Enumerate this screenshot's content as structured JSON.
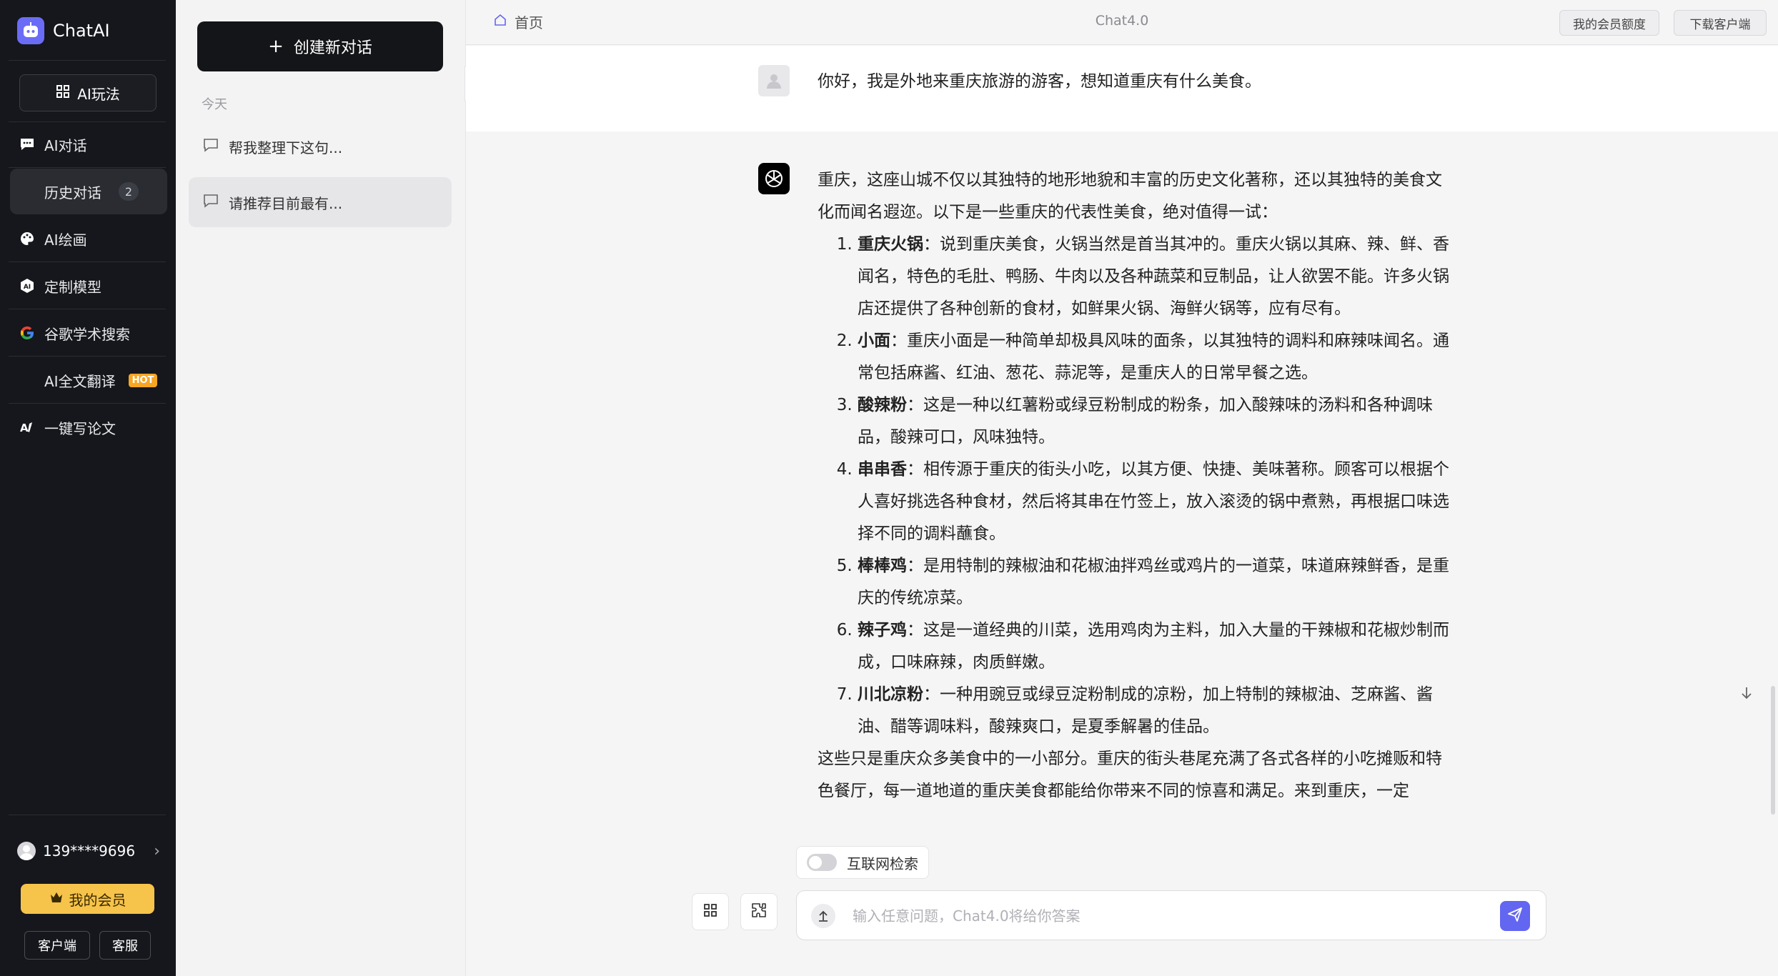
{
  "app": {
    "name": "ChatAI",
    "accent": "#6b6cf6"
  },
  "sidebar": {
    "ai_play_label": "AI玩法",
    "items": [
      {
        "label": "AI对话",
        "icon": "chat-bubble-icon"
      },
      {
        "label": "历史对话",
        "icon": "",
        "count": "2"
      },
      {
        "label": "AI绘画",
        "icon": "palette-icon"
      },
      {
        "label": "定制模型",
        "icon": "ai-model-icon"
      },
      {
        "label": "谷歌学术搜索",
        "icon": "google-icon"
      },
      {
        "label": "AI全文翻译",
        "icon": "",
        "badge": "HOT"
      },
      {
        "label": "一键写论文",
        "icon": "ai-write-icon"
      }
    ],
    "user_phone": "139****9696",
    "member_button": "我的会员",
    "client_button": "客户端",
    "service_button": "客服"
  },
  "conversations": {
    "new_chat_label": "创建新对话",
    "group_label": "今天",
    "items": [
      {
        "title": "帮我整理下这句..."
      },
      {
        "title": "请推荐目前最有..."
      }
    ]
  },
  "header": {
    "home_label": "首页",
    "model_title": "Chat4.0",
    "quota_button": "我的会员额度",
    "download_button": "下载客户端"
  },
  "chat": {
    "user_message": "你好，我是外地来重庆旅游的游客，想知道重庆有什么美食。",
    "intro": "重庆，这座山城不仅以其独特的地形地貌和丰富的历史文化著称，还以其独特的美食文化而闻名遐迩。以下是一些重庆的代表性美食，绝对值得一试：",
    "items": [
      {
        "name": "重庆火锅",
        "desc": "：说到重庆美食，火锅当然是首当其冲的。重庆火锅以其麻、辣、鲜、香闻名，特色的毛肚、鸭肠、牛肉以及各种蔬菜和豆制品，让人欲罢不能。许多火锅店还提供了各种创新的食材，如鲜果火锅、海鲜火锅等，应有尽有。"
      },
      {
        "name": "小面",
        "desc": "：重庆小面是一种简单却极具风味的面条，以其独特的调料和麻辣味闻名。通常包括麻酱、红油、葱花、蒜泥等，是重庆人的日常早餐之选。"
      },
      {
        "name": "酸辣粉",
        "desc": "：这是一种以红薯粉或绿豆粉制成的粉条，加入酸辣味的汤料和各种调味品，酸辣可口，风味独特。"
      },
      {
        "name": "串串香",
        "desc": "：相传源于重庆的街头小吃，以其方便、快捷、美味著称。顾客可以根据个人喜好挑选各种食材，然后将其串在竹签上，放入滚烫的锅中煮熟，再根据口味选择不同的调料蘸食。"
      },
      {
        "name": "棒棒鸡",
        "desc": "：是用特制的辣椒油和花椒油拌鸡丝或鸡片的一道菜，味道麻辣鲜香，是重庆的传统凉菜。"
      },
      {
        "name": "辣子鸡",
        "desc": "：这是一道经典的川菜，选用鸡肉为主料，加入大量的干辣椒和花椒炒制而成，口味麻辣，肉质鲜嫩。"
      },
      {
        "name": "川北凉粉",
        "desc": "：一种用豌豆或绿豆淀粉制成的凉粉，加上特制的辣椒油、芝麻酱、酱油、醋等调味料，酸辣爽口，是夏季解暑的佳品。"
      }
    ],
    "outro": "这些只是重庆众多美食中的一小部分。重庆的街头巷尾充满了各式各样的小吃摊贩和特色餐厅，每一道地道的重庆美食都能给你带来不同的惊喜和满足。来到重庆，一定"
  },
  "composer": {
    "web_search_label": "互联网检索",
    "web_search_enabled": false,
    "placeholder": "输入任意问题，Chat4.0将给你答案",
    "value": ""
  }
}
